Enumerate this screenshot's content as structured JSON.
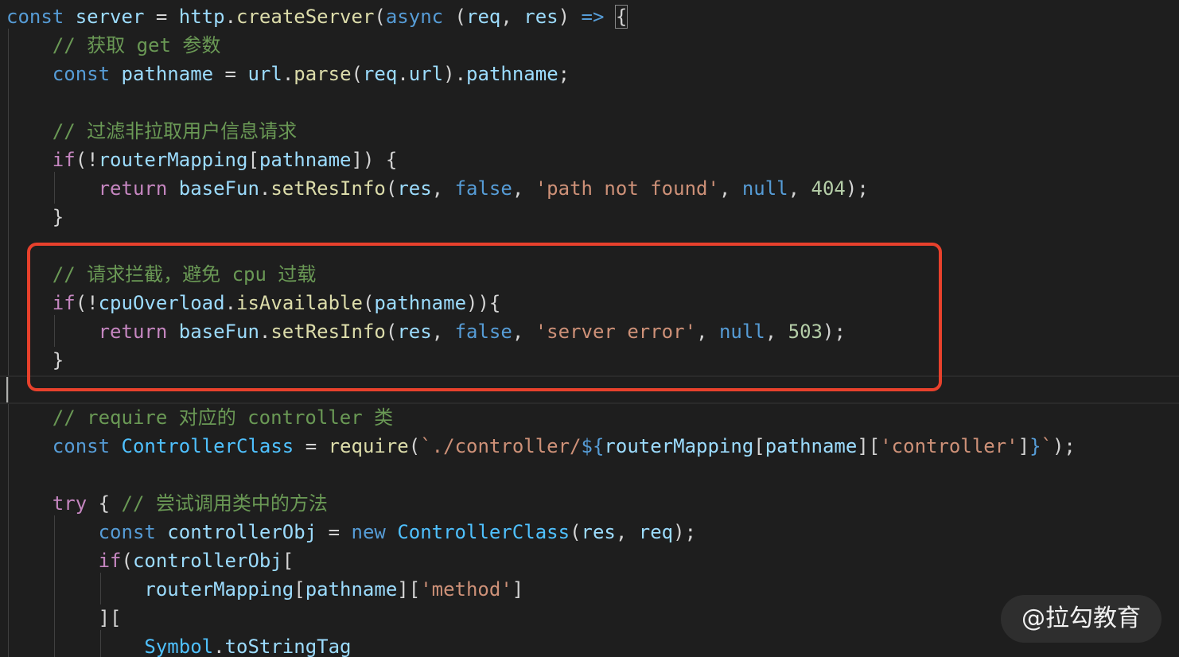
{
  "editor": {
    "lines": [
      [
        {
          "t": "const",
          "c": "kw"
        },
        {
          "t": " ",
          "c": "pun"
        },
        {
          "t": "server",
          "c": "var"
        },
        {
          "t": " = ",
          "c": "pun"
        },
        {
          "t": "http",
          "c": "var"
        },
        {
          "t": ".",
          "c": "pun"
        },
        {
          "t": "createServer",
          "c": "fn"
        },
        {
          "t": "(",
          "c": "pun"
        },
        {
          "t": "async",
          "c": "kw"
        },
        {
          "t": " (",
          "c": "pun"
        },
        {
          "t": "req",
          "c": "var"
        },
        {
          "t": ", ",
          "c": "pun"
        },
        {
          "t": "res",
          "c": "var"
        },
        {
          "t": ") ",
          "c": "pun"
        },
        {
          "t": "=>",
          "c": "kw"
        },
        {
          "t": " ",
          "c": "pun"
        },
        {
          "t": "{",
          "c": "brk"
        }
      ],
      [
        {
          "t": "    ",
          "c": "pun"
        },
        {
          "t": "// 获取 get 参数",
          "c": "cmt"
        }
      ],
      [
        {
          "t": "    ",
          "c": "pun"
        },
        {
          "t": "const",
          "c": "kw"
        },
        {
          "t": " ",
          "c": "pun"
        },
        {
          "t": "pathname",
          "c": "var"
        },
        {
          "t": " = ",
          "c": "pun"
        },
        {
          "t": "url",
          "c": "var"
        },
        {
          "t": ".",
          "c": "pun"
        },
        {
          "t": "parse",
          "c": "fn"
        },
        {
          "t": "(",
          "c": "pun"
        },
        {
          "t": "req",
          "c": "var"
        },
        {
          "t": ".",
          "c": "pun"
        },
        {
          "t": "url",
          "c": "var"
        },
        {
          "t": ").",
          "c": "pun"
        },
        {
          "t": "pathname",
          "c": "var"
        },
        {
          "t": ";",
          "c": "pun"
        }
      ],
      [],
      [
        {
          "t": "    ",
          "c": "pun"
        },
        {
          "t": "// 过滤非拉取用户信息请求",
          "c": "cmt"
        }
      ],
      [
        {
          "t": "    ",
          "c": "pun"
        },
        {
          "t": "if",
          "c": "ctl"
        },
        {
          "t": "(!",
          "c": "pun"
        },
        {
          "t": "routerMapping",
          "c": "var"
        },
        {
          "t": "[",
          "c": "pun"
        },
        {
          "t": "pathname",
          "c": "var"
        },
        {
          "t": "]) {",
          "c": "pun"
        }
      ],
      [
        {
          "t": "        ",
          "c": "pun"
        },
        {
          "t": "return",
          "c": "ctl"
        },
        {
          "t": " ",
          "c": "pun"
        },
        {
          "t": "baseFun",
          "c": "var"
        },
        {
          "t": ".",
          "c": "pun"
        },
        {
          "t": "setResInfo",
          "c": "fn"
        },
        {
          "t": "(",
          "c": "pun"
        },
        {
          "t": "res",
          "c": "var"
        },
        {
          "t": ", ",
          "c": "pun"
        },
        {
          "t": "false",
          "c": "kw"
        },
        {
          "t": ", ",
          "c": "pun"
        },
        {
          "t": "'path not found'",
          "c": "str"
        },
        {
          "t": ", ",
          "c": "pun"
        },
        {
          "t": "null",
          "c": "kw"
        },
        {
          "t": ", ",
          "c": "pun"
        },
        {
          "t": "404",
          "c": "num"
        },
        {
          "t": ");",
          "c": "pun"
        }
      ],
      [
        {
          "t": "    }",
          "c": "pun"
        }
      ],
      [],
      [
        {
          "t": "    ",
          "c": "pun"
        },
        {
          "t": "// 请求拦截，避免 cpu 过载",
          "c": "cmt"
        }
      ],
      [
        {
          "t": "    ",
          "c": "pun"
        },
        {
          "t": "if",
          "c": "ctl"
        },
        {
          "t": "(!",
          "c": "pun"
        },
        {
          "t": "cpuOverload",
          "c": "var"
        },
        {
          "t": ".",
          "c": "pun"
        },
        {
          "t": "isAvailable",
          "c": "fn"
        },
        {
          "t": "(",
          "c": "pun"
        },
        {
          "t": "pathname",
          "c": "var"
        },
        {
          "t": ")){",
          "c": "pun"
        }
      ],
      [
        {
          "t": "        ",
          "c": "pun"
        },
        {
          "t": "return",
          "c": "ctl"
        },
        {
          "t": " ",
          "c": "pun"
        },
        {
          "t": "baseFun",
          "c": "var"
        },
        {
          "t": ".",
          "c": "pun"
        },
        {
          "t": "setResInfo",
          "c": "fn"
        },
        {
          "t": "(",
          "c": "pun"
        },
        {
          "t": "res",
          "c": "var"
        },
        {
          "t": ", ",
          "c": "pun"
        },
        {
          "t": "false",
          "c": "kw"
        },
        {
          "t": ", ",
          "c": "pun"
        },
        {
          "t": "'server error'",
          "c": "str"
        },
        {
          "t": ", ",
          "c": "pun"
        },
        {
          "t": "null",
          "c": "kw"
        },
        {
          "t": ", ",
          "c": "pun"
        },
        {
          "t": "503",
          "c": "num"
        },
        {
          "t": ");",
          "c": "pun"
        }
      ],
      [
        {
          "t": "    }",
          "c": "pun"
        }
      ],
      [],
      [
        {
          "t": "    ",
          "c": "pun"
        },
        {
          "t": "// require 对应的 controller 类",
          "c": "cmt"
        }
      ],
      [
        {
          "t": "    ",
          "c": "pun"
        },
        {
          "t": "const",
          "c": "kw"
        },
        {
          "t": " ",
          "c": "pun"
        },
        {
          "t": "ControllerClass",
          "c": "cls"
        },
        {
          "t": " = ",
          "c": "pun"
        },
        {
          "t": "require",
          "c": "fn"
        },
        {
          "t": "(",
          "c": "pun"
        },
        {
          "t": "`./controller/",
          "c": "str"
        },
        {
          "t": "${",
          "c": "kw"
        },
        {
          "t": "routerMapping",
          "c": "var"
        },
        {
          "t": "[",
          "c": "pun"
        },
        {
          "t": "pathname",
          "c": "var"
        },
        {
          "t": "][",
          "c": "pun"
        },
        {
          "t": "'controller'",
          "c": "str"
        },
        {
          "t": "]",
          "c": "pun"
        },
        {
          "t": "}",
          "c": "kw"
        },
        {
          "t": "`",
          "c": "str"
        },
        {
          "t": ");",
          "c": "pun"
        }
      ],
      [],
      [
        {
          "t": "    ",
          "c": "pun"
        },
        {
          "t": "try",
          "c": "ctl"
        },
        {
          "t": " { ",
          "c": "pun"
        },
        {
          "t": "// 尝试调用类中的方法",
          "c": "cmt"
        }
      ],
      [
        {
          "t": "        ",
          "c": "pun"
        },
        {
          "t": "const",
          "c": "kw"
        },
        {
          "t": " ",
          "c": "pun"
        },
        {
          "t": "controllerObj",
          "c": "var"
        },
        {
          "t": " = ",
          "c": "pun"
        },
        {
          "t": "new",
          "c": "kw"
        },
        {
          "t": " ",
          "c": "pun"
        },
        {
          "t": "ControllerClass",
          "c": "cls"
        },
        {
          "t": "(",
          "c": "pun"
        },
        {
          "t": "res",
          "c": "var"
        },
        {
          "t": ", ",
          "c": "pun"
        },
        {
          "t": "req",
          "c": "var"
        },
        {
          "t": ");",
          "c": "pun"
        }
      ],
      [
        {
          "t": "        ",
          "c": "pun"
        },
        {
          "t": "if",
          "c": "ctl"
        },
        {
          "t": "(",
          "c": "pun"
        },
        {
          "t": "controllerObj",
          "c": "var"
        },
        {
          "t": "[",
          "c": "pun"
        }
      ],
      [
        {
          "t": "            ",
          "c": "pun"
        },
        {
          "t": "routerMapping",
          "c": "var"
        },
        {
          "t": "[",
          "c": "pun"
        },
        {
          "t": "pathname",
          "c": "var"
        },
        {
          "t": "][",
          "c": "pun"
        },
        {
          "t": "'method'",
          "c": "str"
        },
        {
          "t": "]",
          "c": "pun"
        }
      ],
      [
        {
          "t": "        ][",
          "c": "pun"
        }
      ],
      [
        {
          "t": "            ",
          "c": "pun"
        },
        {
          "t": "Symbol",
          "c": "cls"
        },
        {
          "t": ".",
          "c": "pun"
        },
        {
          "t": "toStringTag",
          "c": "var"
        }
      ]
    ]
  },
  "watermark": {
    "text": "@拉勾教育"
  }
}
